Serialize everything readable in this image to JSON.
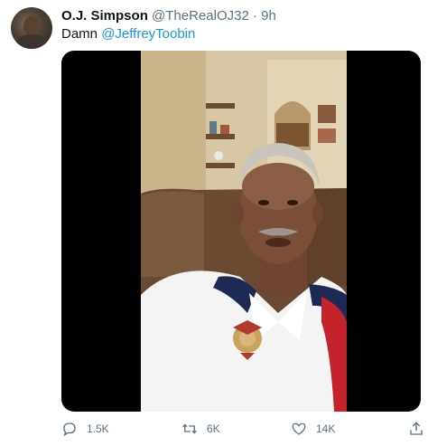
{
  "tweet": {
    "author_name": "O.J. Simpson",
    "handle": "@TheRealOJ32",
    "separator": "·",
    "time": "9h",
    "text_prefix": "Damn ",
    "mention": "@JeffreyToobin"
  },
  "media": {
    "type": "video",
    "icon": "video-frame"
  },
  "actions": {
    "reply_count": "1.5K",
    "retweet_count": "6K",
    "like_count": "14K",
    "reply_icon": "reply-icon",
    "retweet_icon": "retweet-icon",
    "like_icon": "like-icon",
    "share_icon": "share-icon"
  },
  "colors": {
    "link": "#1b95e0",
    "secondary_text": "#5b7083",
    "primary_text": "#0f1419"
  }
}
